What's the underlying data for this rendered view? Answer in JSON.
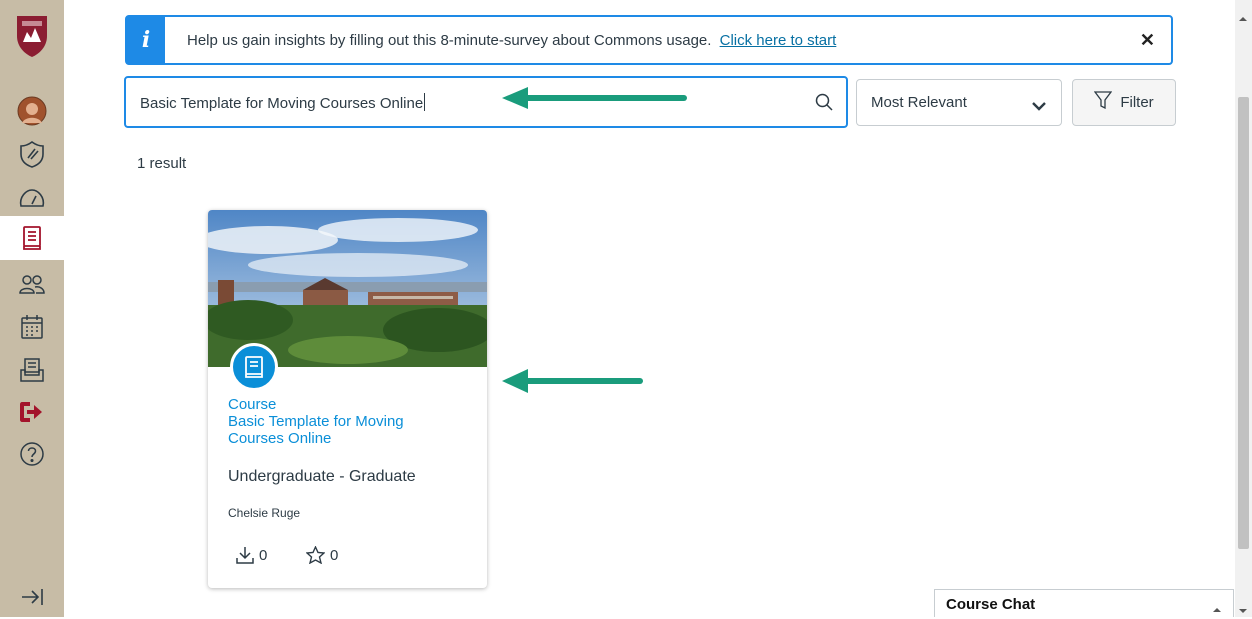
{
  "banner": {
    "text": "Help us gain insights by filling out this 8-minute-survey about Commons usage.",
    "link_text": "Click here to start",
    "close_glyph": "✕",
    "icon": "info-icon",
    "accent": "#1e8ae6"
  },
  "search": {
    "value": "Basic Template for Moving Courses Online",
    "icon": "search-icon"
  },
  "sort": {
    "selected": "Most Relevant",
    "icon": "chevron-down-icon"
  },
  "filter": {
    "label": "Filter",
    "icon": "filter-icon"
  },
  "results": {
    "count_text": "1 result"
  },
  "card": {
    "type": "Course",
    "title": "Basic Template for Moving Courses Online",
    "level": "Undergraduate - Graduate",
    "author": "Chelsie Ruge",
    "downloads": "0",
    "favorites": "0",
    "badge_color": "#0b8fd8"
  },
  "global_nav": {
    "items": [
      "logo",
      "account",
      "admin",
      "dashboard",
      "courses",
      "groups",
      "calendar",
      "inbox",
      "commons",
      "help",
      "collapse"
    ],
    "active": "courses",
    "background": "#c7bca6"
  },
  "course_chat": {
    "title": "Course Chat"
  },
  "annotation": {
    "arrow_color": "#1a9c7c"
  }
}
